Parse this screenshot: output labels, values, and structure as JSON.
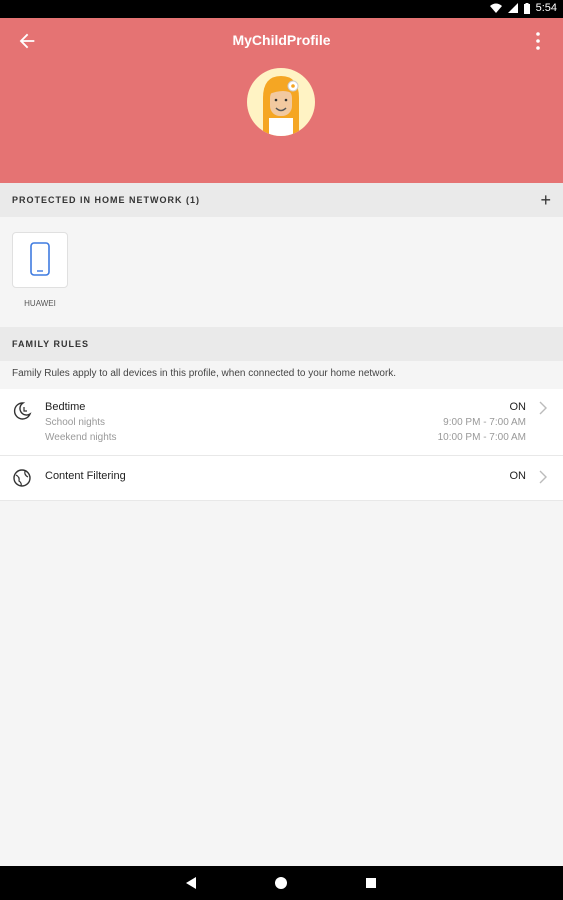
{
  "status_bar": {
    "time": "5:54"
  },
  "app_bar": {
    "title": "MyChildProfile"
  },
  "sections": {
    "protected": {
      "label": "PROTECTED IN HOME NETWORK (1)"
    },
    "family_rules": {
      "label": "FAMILY RULES"
    }
  },
  "device": {
    "name": "HUAWEI"
  },
  "family_rules": {
    "note": "Family Rules apply to all devices in this profile, when connected to your home network.",
    "bedtime": {
      "title": "Bedtime",
      "status": "ON",
      "school_label": "School nights",
      "school_time": "9:00 PM - 7:00 AM",
      "weekend_label": "Weekend nights",
      "weekend_time": "10:00 PM - 7:00 AM"
    },
    "content_filtering": {
      "title": "Content Filtering",
      "status": "ON"
    }
  },
  "colors": {
    "primary": "#e57373",
    "device_blue": "#3f7be0"
  }
}
